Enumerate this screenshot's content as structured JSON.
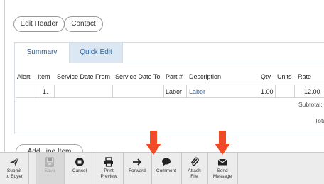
{
  "header": {
    "edit_header_label": "Edit Header",
    "contact_label": "Contact"
  },
  "tabs": [
    {
      "label": "Summary"
    },
    {
      "label": "Quick Edit"
    }
  ],
  "table": {
    "columns": [
      "Alert",
      "Item",
      "Service Date From",
      "Service Date To",
      "Part #",
      "Description",
      "Qty",
      "Units",
      "Rate"
    ],
    "rows": [
      {
        "alert": "",
        "item": "1.",
        "service_from": "",
        "service_to": "",
        "part": "Labor",
        "description": "Labor",
        "qty": "1.00",
        "units": "",
        "rate": "12.00"
      }
    ],
    "subtotal_label": "Subtotal:",
    "total_label": "Tota"
  },
  "add_line_item_label": "Add Line Item",
  "toolbar": {
    "buttons": [
      {
        "label_line1": "Submit",
        "label_line2": "to Buyer",
        "icon": "paper-plane-icon"
      },
      {
        "label_line1": "Save",
        "label_line2": "",
        "icon": "floppy-icon"
      },
      {
        "label_line1": "Cancel",
        "label_line2": "",
        "icon": "stop-icon"
      },
      {
        "label_line1": "Print",
        "label_line2": "Preview",
        "icon": "printer-icon"
      },
      {
        "label_line1": "Forward",
        "label_line2": "",
        "icon": "arrow-right-icon"
      },
      {
        "label_line1": "Comment",
        "label_line2": "",
        "icon": "speech-bubble-icon"
      },
      {
        "label_line1": "Attach",
        "label_line2": "File",
        "icon": "paperclip-icon"
      },
      {
        "label_line1": "Send",
        "label_line2": "Message",
        "icon": "envelope-icon"
      }
    ]
  },
  "colors": {
    "link": "#2b6cb0",
    "tab_active_bg": "#dbe7f3",
    "annotation_arrow": "#f04a26"
  }
}
